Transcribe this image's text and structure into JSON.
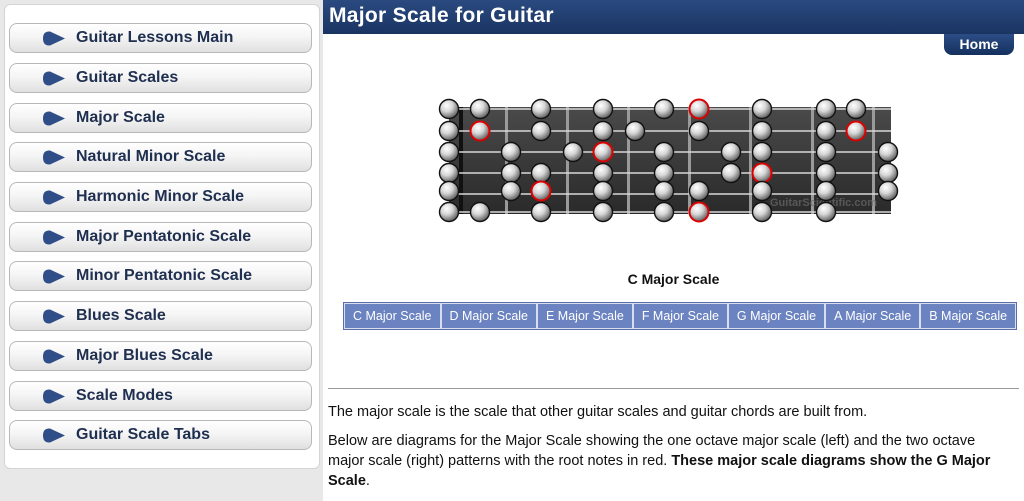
{
  "sidebar": {
    "items": [
      {
        "label": "Guitar Lessons Main"
      },
      {
        "label": "Guitar Scales"
      },
      {
        "label": "Major Scale"
      },
      {
        "label": "Natural Minor Scale"
      },
      {
        "label": "Harmonic Minor Scale"
      },
      {
        "label": "Major Pentatonic Scale"
      },
      {
        "label": "Minor Pentatonic Scale"
      },
      {
        "label": "Blues Scale"
      },
      {
        "label": "Major Blues Scale"
      },
      {
        "label": "Scale Modes"
      },
      {
        "label": "Guitar Scale Tabs"
      }
    ]
  },
  "header": {
    "title": "Major Scale for Guitar",
    "home_label": "Home"
  },
  "diagram": {
    "caption": "C Major Scale",
    "watermark": "GuitarScientific.com"
  },
  "scale_tabs": [
    "C Major Scale",
    "D Major Scale",
    "E Major Scale",
    "F Major Scale",
    "G Major Scale",
    "A Major Scale",
    "B Major Scale"
  ],
  "content": {
    "intro": "The major scale is the scale that other guitar scales and guitar chords are built from.",
    "desc_start": "Below are diagrams for the Major Scale showing the one octave major scale (left) and the two octave major scale (right) patterns with the root notes in red.",
    "desc_bold": "These major scale diagrams show the G Major Scale",
    "desc_end": "."
  },
  "colors": {
    "header_bg": "#1f3c70",
    "nav_text": "#1f2f50",
    "tab_bg": "#6b83c0",
    "root_note": "#dd0000"
  }
}
